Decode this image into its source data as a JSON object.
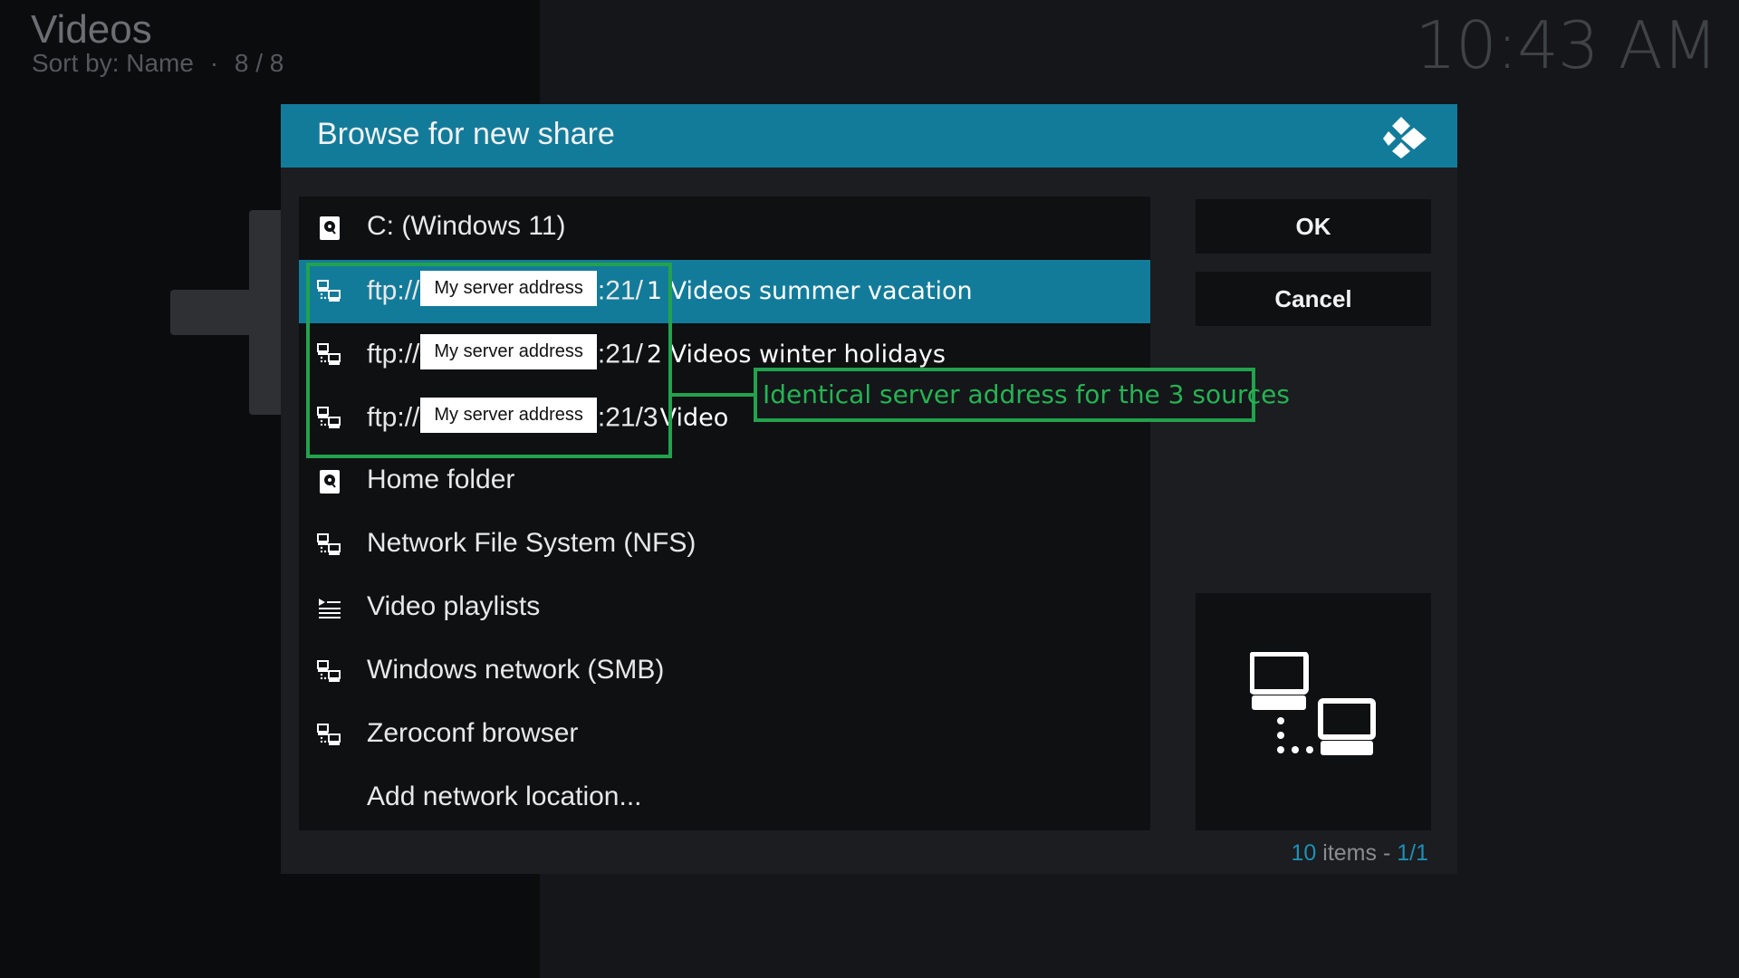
{
  "header": {
    "title": "Videos",
    "sort_label": "Sort by: Name",
    "separator": "·",
    "position": "8 / 8",
    "clock": "10:43 AM"
  },
  "dialog": {
    "title": "Browse for new share",
    "items": [
      {
        "icon": "hard-drive-icon",
        "label": "C: (Windows 11)"
      },
      {
        "icon": "network-icon",
        "prefix": "ftp://",
        "redacted": "My server address",
        "port": ":21/",
        "suffix": "1 Videos summer vacation",
        "selected": true
      },
      {
        "icon": "network-icon",
        "prefix": "ftp://",
        "redacted": "My server address",
        "port": ":21/",
        "suffix": "2 Videos winter holidays"
      },
      {
        "icon": "network-icon",
        "prefix": "ftp://",
        "redacted": "My server address",
        "port": ":21/3",
        "suffix": "Video"
      },
      {
        "icon": "hard-drive-icon",
        "label": "Home folder"
      },
      {
        "icon": "network-icon",
        "label": "Network File System (NFS)"
      },
      {
        "icon": "playlist-icon",
        "label": "Video playlists"
      },
      {
        "icon": "network-icon",
        "label": "Windows network (SMB)"
      },
      {
        "icon": "network-icon",
        "label": "Zeroconf browser"
      },
      {
        "icon": "",
        "label": "Add network location..."
      }
    ],
    "ok_label": "OK",
    "cancel_label": "Cancel",
    "count": {
      "total": "10",
      "word": " items - ",
      "page": "1/1"
    }
  },
  "annotation": {
    "text": "Identical server address for the 3 sources",
    "color": "#23a24d"
  },
  "colors": {
    "accent": "#137b9a",
    "background": "#0b0c0e",
    "panel": "#1b1d20"
  }
}
